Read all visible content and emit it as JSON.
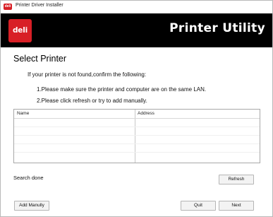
{
  "window": {
    "title": "Printer Driver Installer",
    "icon_label": "deli"
  },
  "banner": {
    "logo": "deli",
    "title": "Printer Utility"
  },
  "content": {
    "section_title": "Select Printer",
    "message": "If your printer is not found,confirm the following:",
    "step1": "1.Please make sure the printer and computer are on the same LAN.",
    "step2": "2.Please click refresh or try to add manually."
  },
  "table": {
    "columns": [
      "Name",
      "Address"
    ],
    "rows": []
  },
  "status": {
    "text": "Search done"
  },
  "buttons": {
    "refresh": "Refresh",
    "add_manually": "Add Manully",
    "quit": "Quit",
    "next": "Next"
  },
  "colors": {
    "brand_red": "#d81f26",
    "banner_bg": "#000000"
  }
}
